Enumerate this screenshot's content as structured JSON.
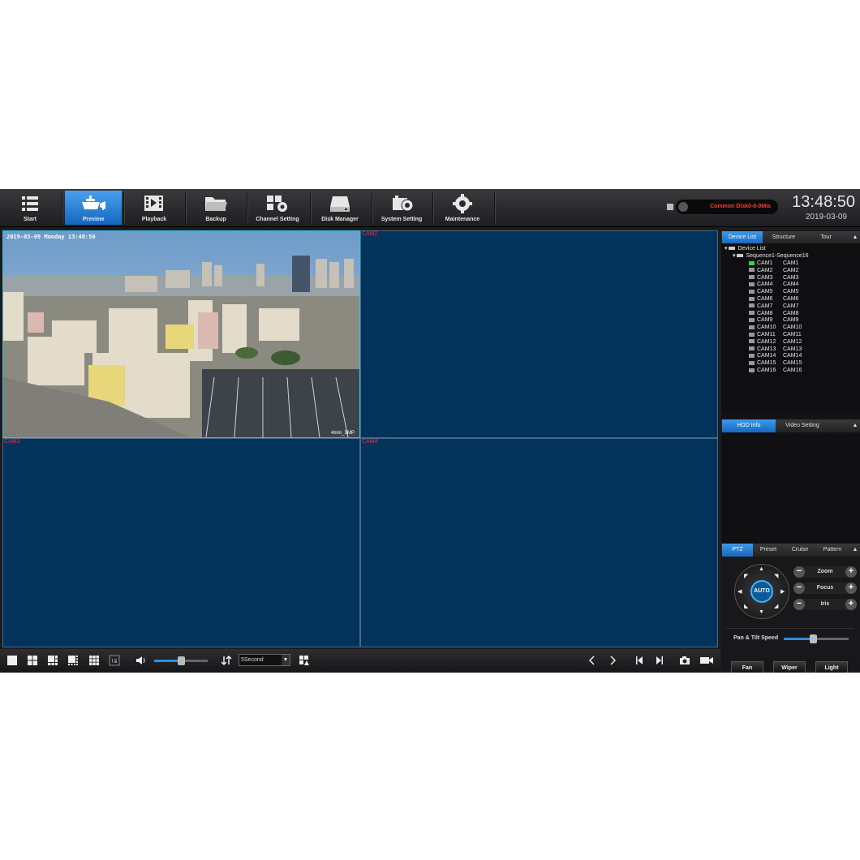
{
  "nav": {
    "items": [
      {
        "label": "Start",
        "icon": "list-icon"
      },
      {
        "label": "Preview",
        "icon": "camera-icon"
      },
      {
        "label": "Playback",
        "icon": "film-icon"
      },
      {
        "label": "Backup",
        "icon": "folder-icon"
      },
      {
        "label": "Channel Setting",
        "icon": "channel-settings-icon"
      },
      {
        "label": "Disk Manager",
        "icon": "disk-icon"
      },
      {
        "label": "System Setting",
        "icon": "system-settings-icon"
      },
      {
        "label": "Maintenance",
        "icon": "gear-icon"
      }
    ],
    "active": "Preview"
  },
  "status": {
    "disk_message": "Common Disk0-0-0Mis",
    "time": "13:48:50",
    "date": "2019-03-09"
  },
  "tiles": [
    {
      "label": "",
      "osd": "2019-03-09 Monday 13:48:50",
      "osd_bottom": "4mm_5MP"
    },
    {
      "label": "CAM2"
    },
    {
      "label": "CAM3"
    },
    {
      "label": "CAM4"
    }
  ],
  "toolbar": {
    "interval": "5Second"
  },
  "device_panel": {
    "tabs": [
      "Device List",
      "Structure",
      "Tour"
    ],
    "root": "Device List",
    "group": "Sequence1-Sequence16",
    "cameras": [
      {
        "name": "CAM1",
        "alias": "CAM1"
      },
      {
        "name": "CAM2",
        "alias": "CAM2"
      },
      {
        "name": "CAM3",
        "alias": "CAM3"
      },
      {
        "name": "CAM4",
        "alias": "CAM4"
      },
      {
        "name": "CAM5",
        "alias": "CAM5"
      },
      {
        "name": "CAM6",
        "alias": "CAM6"
      },
      {
        "name": "CAM7",
        "alias": "CAM7"
      },
      {
        "name": "CAM8",
        "alias": "CAM8"
      },
      {
        "name": "CAM9",
        "alias": "CAM9"
      },
      {
        "name": "CAM10",
        "alias": "CAM10"
      },
      {
        "name": "CAM11",
        "alias": "CAM11"
      },
      {
        "name": "CAM12",
        "alias": "CAM12"
      },
      {
        "name": "CAM13",
        "alias": "CAM13"
      },
      {
        "name": "CAM14",
        "alias": "CAM14"
      },
      {
        "name": "CAM15",
        "alias": "CAM15"
      },
      {
        "name": "CAM16",
        "alias": "CAM16"
      }
    ]
  },
  "info_panel": {
    "tabs": [
      "HDD Info",
      "Video Setting"
    ]
  },
  "ptz": {
    "tabs": [
      "PTZ",
      "Preset",
      "Cruise",
      "Pattern"
    ],
    "auto_label": "AUTO",
    "controls": [
      "Zoom",
      "Focus",
      "Iris"
    ],
    "speed_label": "Pan & Tilt Speed",
    "buttons": [
      "Fan",
      "Wiper",
      "Light"
    ]
  },
  "colors": {
    "accent": "#1a74cf",
    "tile_bg": "#02335a",
    "alert_text": "#ff2a2a"
  }
}
